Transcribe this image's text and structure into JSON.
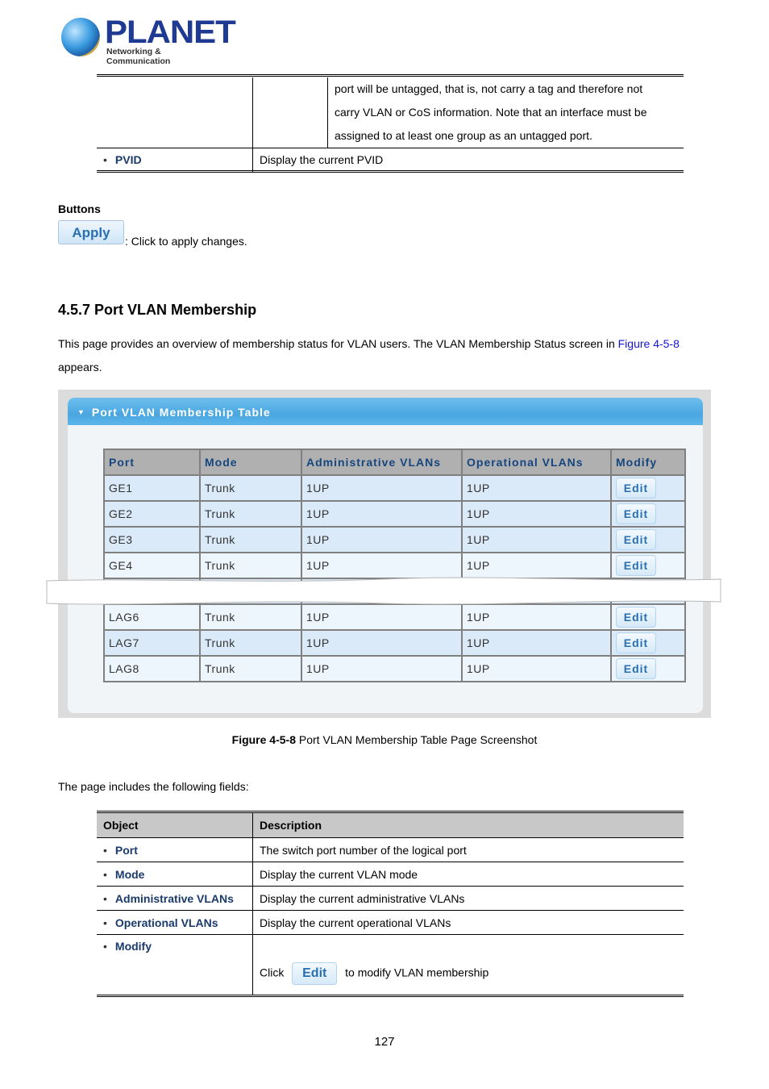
{
  "logo": {
    "name": "PLANET",
    "tagline": "Networking & Communication"
  },
  "top_table": {
    "rows": [
      {
        "object": "",
        "sub": "",
        "description_lines": [
          "port will be untagged, that is, not carry a tag and therefore not",
          "carry VLAN or CoS information. Note that an interface must be",
          "assigned to at least one group as an untagged port."
        ]
      },
      {
        "object": "PVID",
        "description": "Display the current PVID"
      }
    ]
  },
  "buttons_section": {
    "heading": "Buttons",
    "apply_label": "Apply",
    "apply_description": ": Click to apply changes."
  },
  "section": {
    "title": "4.5.7 Port VLAN Membership",
    "intro_before_link": "This page provides an overview of membership status for VLAN users. The VLAN Membership Status screen in ",
    "intro_link": "Figure 4-5-8",
    "intro_after": "appears."
  },
  "figure": {
    "panel_title": "Port VLAN Membership Table",
    "columns": [
      "Port",
      "Mode",
      "Administrative VLANs",
      "Operational VLANs",
      "Modify"
    ],
    "rows_before_break": [
      {
        "port": "GE1",
        "mode": "Trunk",
        "admin": "1UP",
        "oper": "1UP",
        "modify": "Edit"
      },
      {
        "port": "GE2",
        "mode": "Trunk",
        "admin": "1UP",
        "oper": "1UP",
        "modify": "Edit"
      },
      {
        "port": "GE3",
        "mode": "Trunk",
        "admin": "1UP",
        "oper": "1UP",
        "modify": "Edit"
      },
      {
        "port": "GE4",
        "mode": "Trunk",
        "admin": "1UP",
        "oper": "1UP",
        "modify": "Edit"
      }
    ],
    "rows_after_break": [
      {
        "port": "LAG6",
        "mode": "Trunk",
        "admin": "1UP",
        "oper": "1UP",
        "modify": "Edit"
      },
      {
        "port": "LAG7",
        "mode": "Trunk",
        "admin": "1UP",
        "oper": "1UP",
        "modify": "Edit"
      },
      {
        "port": "LAG8",
        "mode": "Trunk",
        "admin": "1UP",
        "oper": "1UP",
        "modify": "Edit"
      }
    ],
    "caption_bold": "Figure 4-5-8",
    "caption_text": " Port VLAN Membership Table Page Screenshot"
  },
  "fields_intro": "The page includes the following fields:",
  "fields_table": {
    "headers": [
      "Object",
      "Description"
    ],
    "rows": [
      {
        "object": "Port",
        "description": "The switch port number of the logical port"
      },
      {
        "object": "Mode",
        "description": "Display the current VLAN mode"
      },
      {
        "object": "Administrative VLANs",
        "description": "Display the current administrative VLANs"
      },
      {
        "object": "Operational VLANs",
        "description": "Display the current operational VLANs"
      }
    ],
    "modify_row": {
      "object": "Modify",
      "before": "Click",
      "button": "Edit",
      "after": "to modify VLAN membership"
    }
  },
  "page_number": "127"
}
